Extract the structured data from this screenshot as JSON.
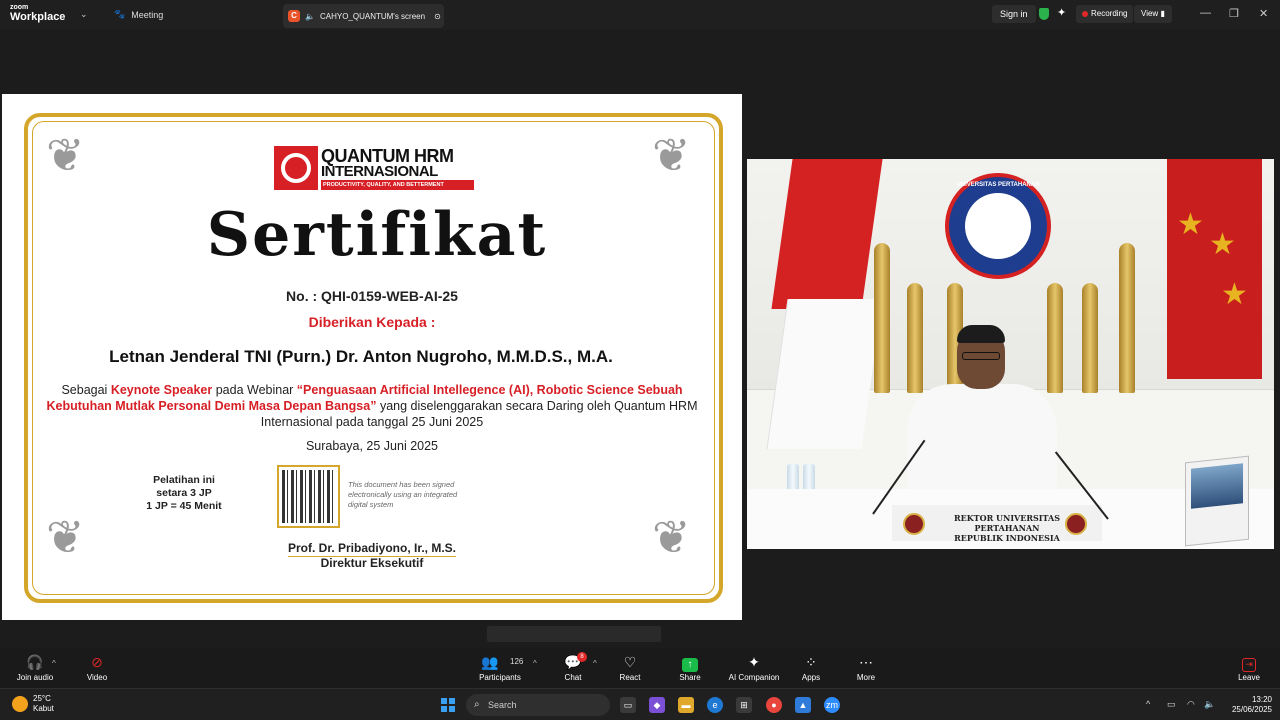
{
  "titlebar": {
    "brand_top": "zoom",
    "brand_bottom": "Workplace",
    "meeting_label": "Meeting",
    "share_badge": "C",
    "share_tab_label": "CAHYO_QUANTUM's screen",
    "signin_label": "Sign in",
    "recording_label": "Recording",
    "view_label": "View"
  },
  "certificate": {
    "logo_line1": "QUANTUM HRM",
    "logo_line2": "INTERNASIONAL",
    "logo_tagline": "PRODUCTIVITY, QUALITY, AND BETTERMENT",
    "title": "Sertifikat",
    "number": "No. : QHI-0159-WEB-AI-25",
    "given_to": "Diberikan Kepada :",
    "recipient": "Letnan Jenderal TNI (Purn.) Dr. Anton Nugroho, M.M.D.S., M.A.",
    "body_prefix": "Sebagai ",
    "body_role": "Keynote Speaker",
    "body_mid": " pada Webinar ",
    "body_topic": "“Penguasaan Artificial Intellegence (AI), Robotic Science Sebuah Kebutuhan Mutlak Personal Demi Masa Depan Bangsa”",
    "body_suffix": " yang diselenggarakan secara Daring oleh Quantum HRM Internasional pada tanggal 25 Juni 2025",
    "place_date": "Surabaya, 25 Juni 2025",
    "training_line1": "Pelatihan ini",
    "training_line2": "setara 3 JP",
    "training_line3": "1 JP = 45 Menit",
    "signature_note": "This document has been signed electronically using an integrated digital system",
    "signer_name": "Prof. Dr. Pribadiyono, Ir., M.S.",
    "signer_title": "Direktur Eksekutif"
  },
  "video": {
    "emblem_text": "UNIVERSITAS PERTAHANAN",
    "desk_sign_line1": "REKTOR UNIVERSITAS PERTAHANAN",
    "desk_sign_line2": "REPUBLIK INDONESIA"
  },
  "toolbar": {
    "join_audio": "Join audio",
    "video": "Video",
    "participants": "Participants",
    "participants_count": "126",
    "chat": "Chat",
    "chat_badge": "8",
    "react": "React",
    "share": "Share",
    "ai_companion": "AI Companion",
    "apps": "Apps",
    "more": "More",
    "leave": "Leave"
  },
  "taskbar": {
    "temperature": "25°C",
    "weather": "Kabut",
    "search_placeholder": "Search",
    "time": "13:20",
    "date": "25/06/2025"
  },
  "colors": {
    "accent_red": "#d71f26",
    "gold_border": "#d4a62a",
    "share_green": "#1bbb4a",
    "recording_red": "#e02828"
  }
}
